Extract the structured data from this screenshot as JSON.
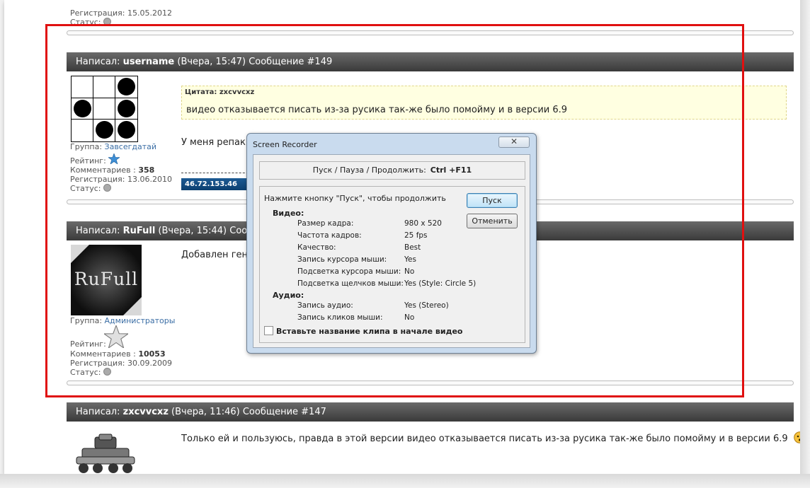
{
  "prev_post": {
    "registration": "Регистрация: 15.05.2012",
    "status": "Статус:"
  },
  "post149": {
    "header": {
      "prefix": "Написал: ",
      "author": "username",
      "meta": " (Вчера, 15:47) Сообщение #149"
    },
    "user": {
      "group_label": "Группа: ",
      "group": "Завсегдатай",
      "rating_label": "Рейтинг:",
      "comments_label": "Комментариев : ",
      "comments": "358",
      "registration": "Регистрация: 13.06.2010",
      "status": "Статус:"
    },
    "quote": {
      "title": "Цитата: zxcvvcxz",
      "text": "видео отказывается писать из-за русика так-же было помойму и в версии 6.9"
    },
    "text": "У меня репак",
    "ip": "46.72.153.46"
  },
  "post148": {
    "header": {
      "prefix": "Написал: ",
      "author": "RuFull",
      "meta": " (Вчера, 15:44) Соо"
    },
    "avatar_text": "RuFull",
    "user": {
      "group_label": "Группа: ",
      "group": "Администраторы",
      "rating_label": "Рейтинг:",
      "comments_label": "Комментариев : ",
      "comments": "10053",
      "registration": "Регистрация: 30.09.2009",
      "status": "Статус:"
    },
    "text": "Добавлен ген"
  },
  "post147": {
    "header": {
      "prefix": "Написал: ",
      "author": "zxcvvcxz",
      "meta": " (Вчера, 11:46) Сообщение #147"
    },
    "text": "Только ей и пользуюсь, правда в этой версии видео отказывается писать из-за русика так-же было помойму и в версии 6.9"
  },
  "dialog": {
    "title": "Screen Recorder",
    "close": "✕",
    "hotkey_label": "Пуск / Пауза / Продолжить:",
    "hotkey_value": "Ctrl +F11",
    "prompt": "Нажмите кнопку \"Пуск\", чтобы продолжить",
    "start_button": "Пуск",
    "cancel_button": "Отменить",
    "video_section": "Видео:",
    "video_rows": [
      {
        "label": "Размер кадра:",
        "value": "980 x 520"
      },
      {
        "label": "Частота кадров:",
        "value": "25 fps"
      },
      {
        "label": "Качество:",
        "value": "Best"
      },
      {
        "label": "Запись курсора мыши:",
        "value": "Yes"
      },
      {
        "label": "Подсветка курсора мыши:",
        "value": "No"
      },
      {
        "label": "Подсветка щелчков мыши:",
        "value": "Yes (Style: Circle 5)"
      }
    ],
    "audio_section": "Аудио:",
    "audio_rows": [
      {
        "label": "Запись аудио:",
        "value": "Yes (Stereo)"
      },
      {
        "label": "Запись кликов мыши:",
        "value": "No"
      }
    ],
    "checkbox_label": "Вставьте название клипа в начале видео"
  },
  "colors": {
    "header_bg": "#4a4a4a",
    "highlight_frame": "#e01010",
    "link": "#3b6ea5",
    "ip_badge": "#1c5a93",
    "quote_bg": "#ffffe1"
  }
}
